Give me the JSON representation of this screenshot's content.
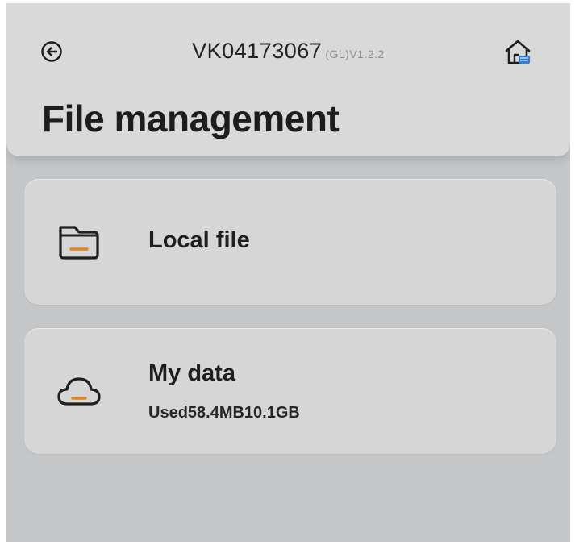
{
  "header": {
    "device_id": "VK04173067",
    "version": "(GL)V1.2.2",
    "page_title": "File management"
  },
  "icons": {
    "back": "arrow-left-circle-icon",
    "home": "home-icon",
    "local": "folder-icon",
    "data": "cloud-icon"
  },
  "items": [
    {
      "label": "Local file"
    },
    {
      "label": "My data",
      "sub": "Used58.4MB10.1GB"
    }
  ],
  "colors": {
    "accent": "#e8821e",
    "home_badge": "#2f7fd8"
  }
}
